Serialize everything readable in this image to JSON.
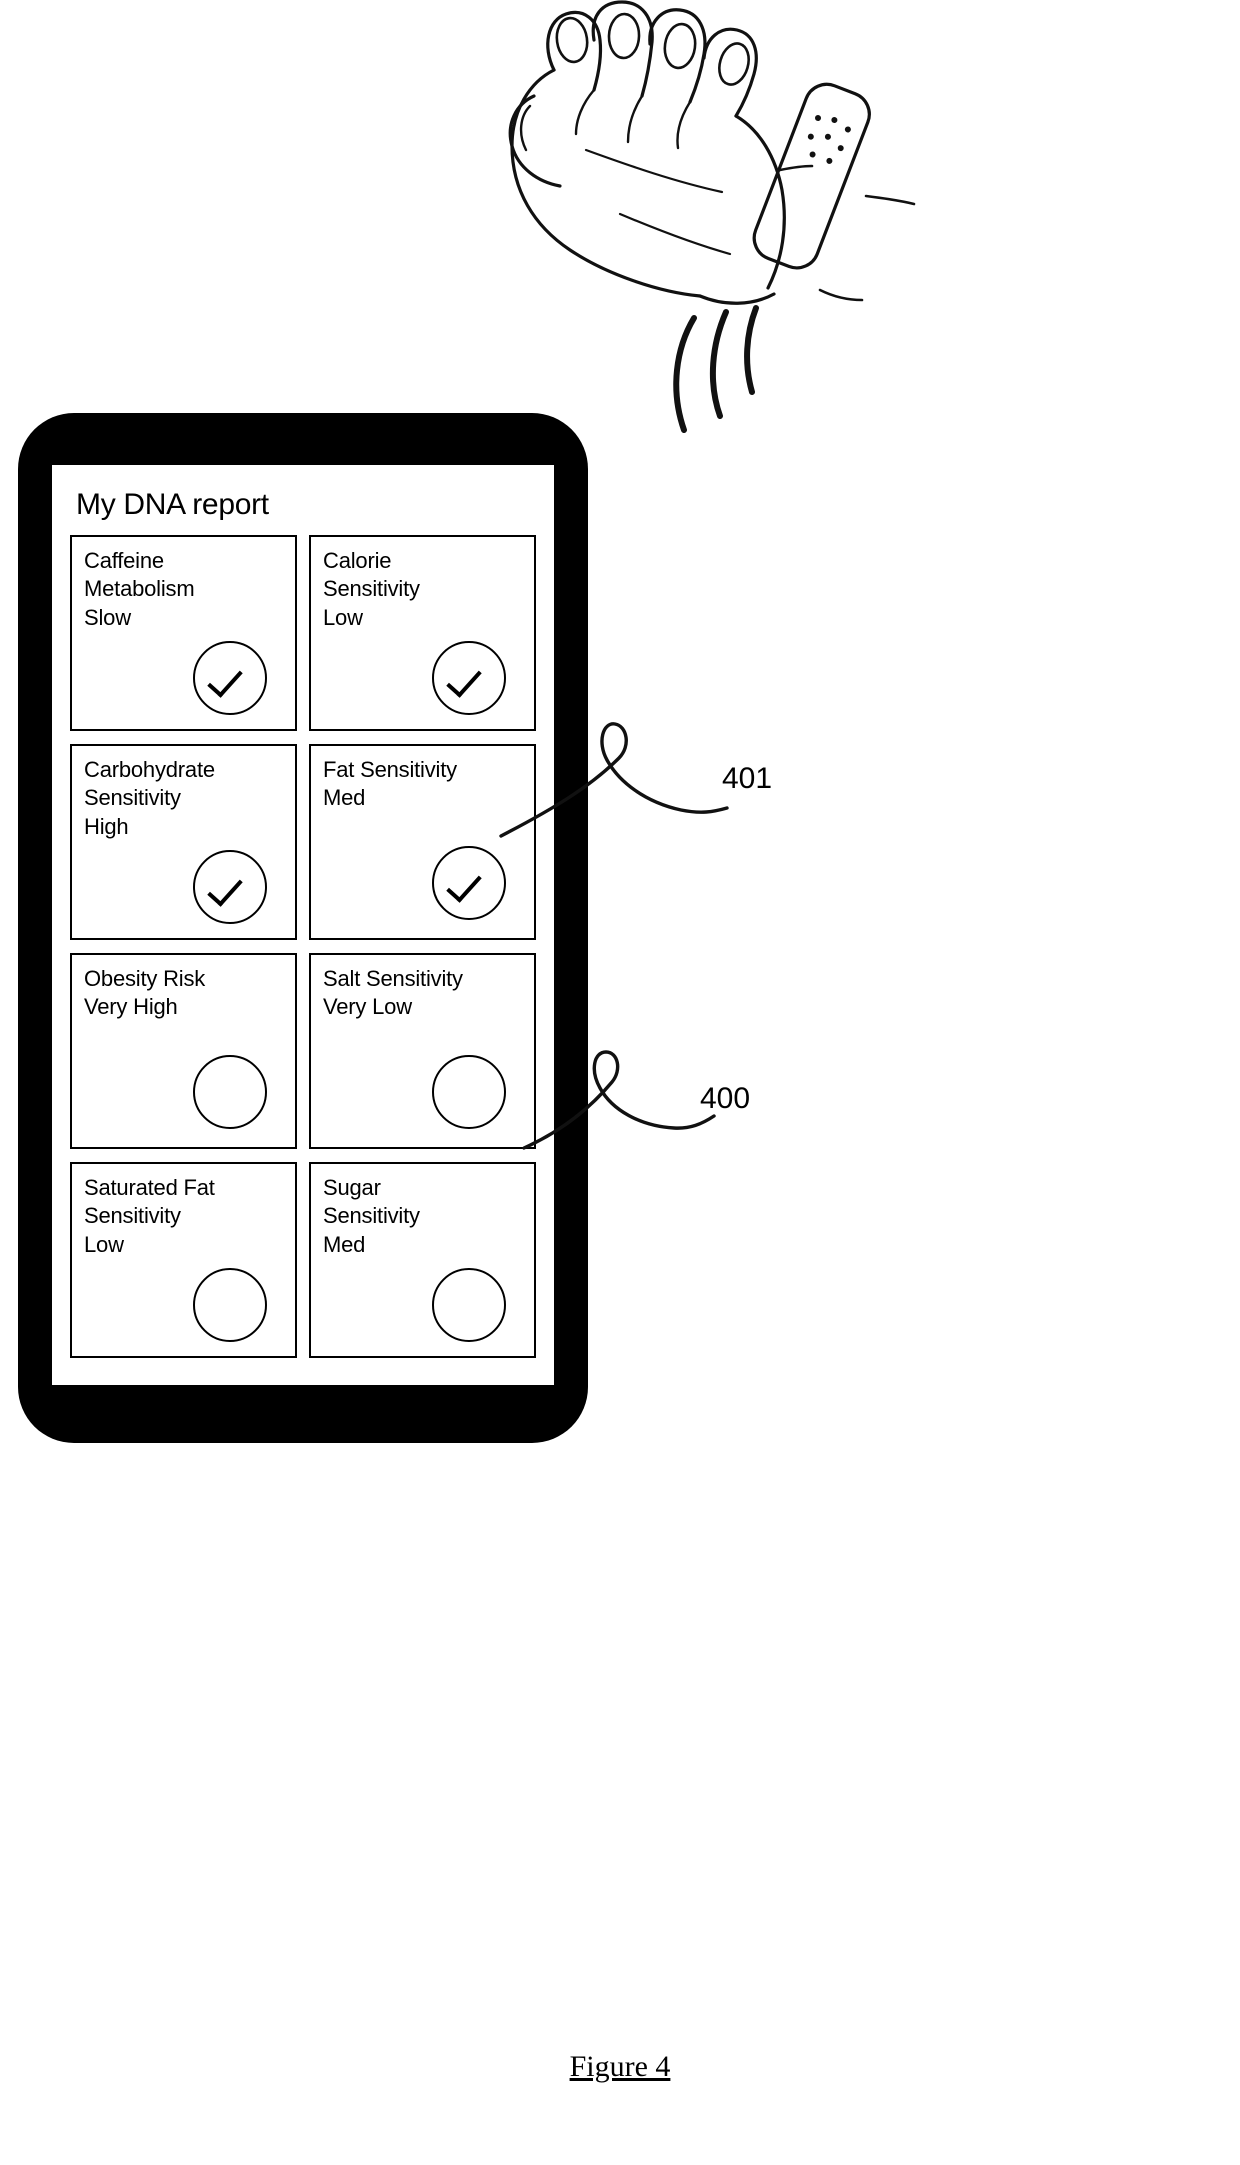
{
  "figure": {
    "caption": "Figure 4",
    "reference_numerals": [
      {
        "id": "401",
        "label": "401"
      },
      {
        "id": "400",
        "label": "400"
      }
    ]
  },
  "device": {
    "type": "smartphone",
    "screen": {
      "title": "My DNA report",
      "cards": [
        {
          "trait": "Caffeine Metabolism",
          "value": "Slow",
          "text": "Caffeine\nMetabolism\nSlow",
          "lines": 3,
          "checked": true
        },
        {
          "trait": "Calorie Sensitivity",
          "value": "Low",
          "text": "Calorie\nSensitivity\nLow",
          "lines": 3,
          "checked": true
        },
        {
          "trait": "Carbohydrate Sensitivity",
          "value": "High",
          "text": "Carbohydrate\nSensitivity\nHigh",
          "lines": 3,
          "checked": true
        },
        {
          "trait": "Fat Sensitivity",
          "value": "Med",
          "text": "Fat Sensitivity\nMed",
          "lines": 2,
          "checked": true
        },
        {
          "trait": "Obesity Risk",
          "value": "Very High",
          "text": "Obesity Risk\nVery High",
          "lines": 2,
          "checked": false
        },
        {
          "trait": "Salt Sensitivity",
          "value": "Very Low",
          "text": "Salt Sensitivity\nVery Low",
          "lines": 2,
          "checked": false
        },
        {
          "trait": "Saturated Fat Sensitivity",
          "value": "Low",
          "text": "Saturated Fat\nSensitivity\nLow",
          "lines": 3,
          "checked": false
        },
        {
          "trait": "Sugar Sensitivity",
          "value": "Med",
          "text": "Sugar\nSensitivity\nMed",
          "lines": 3,
          "checked": false
        }
      ]
    }
  },
  "illustration": {
    "subject": "hand-with-wearable-device",
    "description": "Line drawing of a hand wearing a strap-style wearable sensor with signal waves"
  },
  "colors": {
    "ink": "#000000",
    "background": "#ffffff"
  }
}
